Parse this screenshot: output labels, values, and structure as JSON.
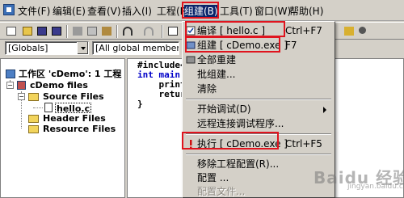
{
  "menubar": {
    "items": [
      "文件(F)",
      "编辑(E)",
      "查看(V)",
      "插入(I)",
      "工程(P)",
      "组建(B)",
      "工具(T)",
      "窗口(W)",
      "帮助(H)"
    ]
  },
  "toolbar": {
    "globals_combo": "[Globals]",
    "members_combo": "[All global member"
  },
  "workspace": {
    "root": "工作区 'cDemo': 1 工程",
    "project": "cDemo files",
    "source_files": "Source Files",
    "file": "hello.c",
    "header_files": "Header Files",
    "resource_files": "Resource Files"
  },
  "editor": {
    "lines": [
      "#include<s",
      "int main()",
      "    printf",
      "    return",
      "}"
    ]
  },
  "build_menu": {
    "compile": {
      "label": "编译 [ hello.c ]",
      "shortcut": "Ctrl+F7"
    },
    "build": {
      "label": "组建 [ cDemo.exe ]",
      "shortcut": "F7"
    },
    "rebuild_all": "全部重建",
    "batch_build": "批组建...",
    "clean": "清除",
    "start_debug": "开始调试(D)",
    "remote_debug": "远程连接调试程序...",
    "execute": {
      "label": "执行 [ cDemo.exe ]",
      "shortcut": "Ctrl+F5"
    },
    "remove_config": "移除工程配置(R)...",
    "configurations": "配置 ...",
    "config_files": "配置文件..."
  },
  "watermark": {
    "brand": "Baidu 经验",
    "url": "jingyan.baidu.com"
  },
  "colors": {
    "highlight_border": "#e0141e",
    "menu_active": "#0a246a",
    "keyword": "#0000c8"
  }
}
